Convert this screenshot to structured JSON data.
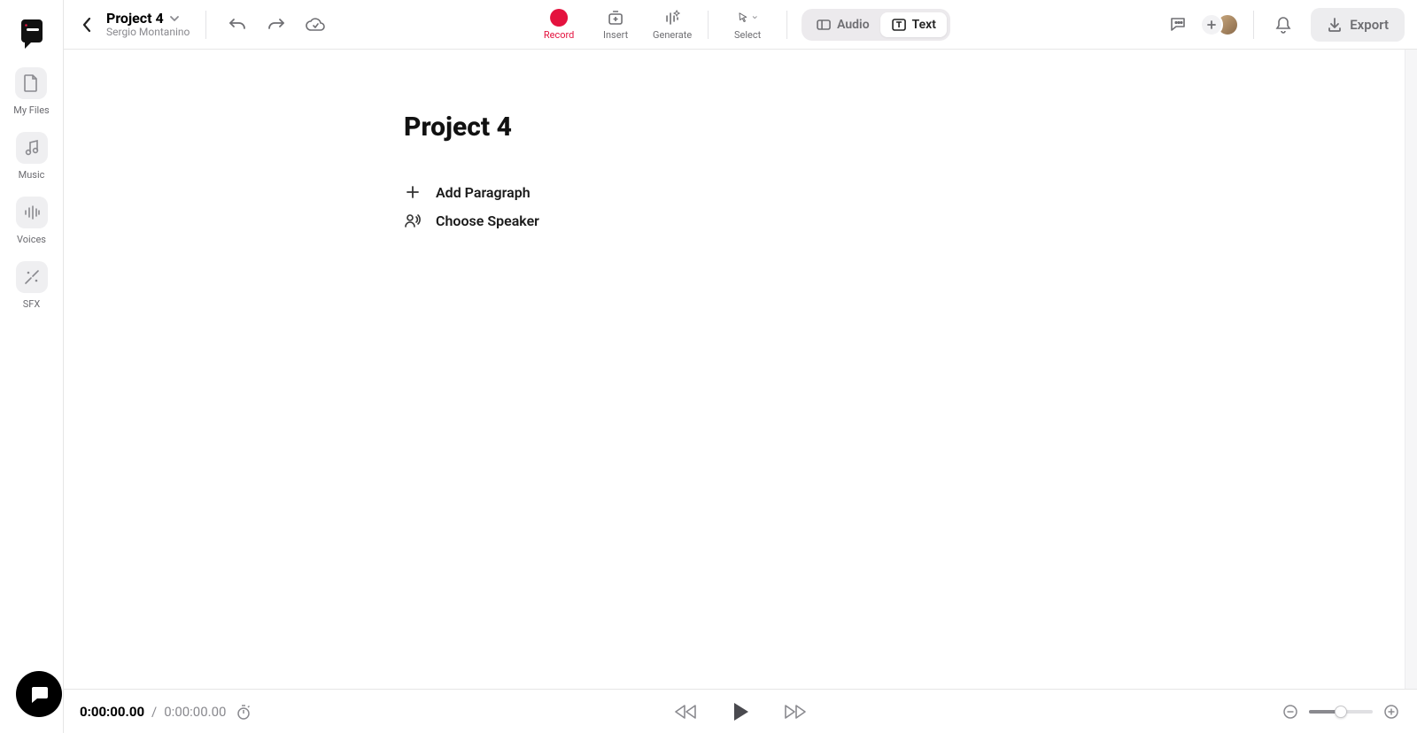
{
  "project": {
    "title": "Project 4",
    "owner": "Sergio Montanino"
  },
  "sidebar": {
    "items": [
      {
        "label": "My Files"
      },
      {
        "label": "Music"
      },
      {
        "label": "Voices"
      },
      {
        "label": "SFX"
      }
    ]
  },
  "topActions": {
    "record": "Record",
    "insert": "Insert",
    "generate": "Generate",
    "select": "Select"
  },
  "viewToggle": {
    "audio": "Audio",
    "text": "Text"
  },
  "export": "Export",
  "doc": {
    "title": "Project 4",
    "addParagraph": "Add Paragraph",
    "chooseSpeaker": "Choose Speaker"
  },
  "playback": {
    "current": "0:00:00.00",
    "separator": "/",
    "duration": "0:00:00.00"
  }
}
